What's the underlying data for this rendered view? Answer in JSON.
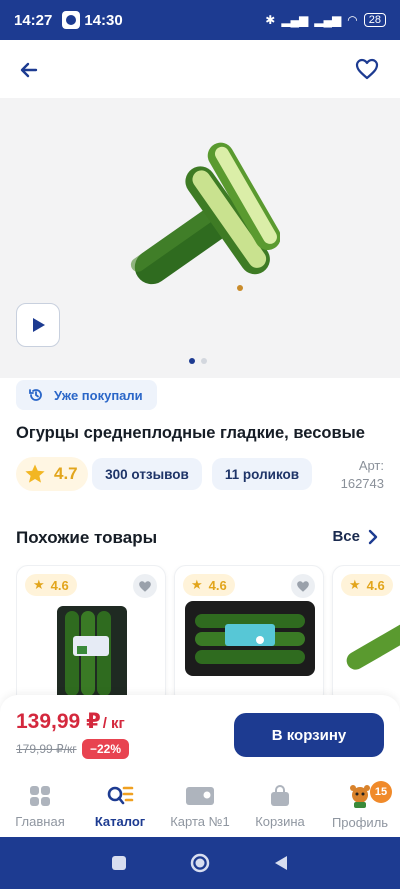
{
  "status_bar": {
    "time": "14:27",
    "second_time": "14:30",
    "battery": "28"
  },
  "icons": {
    "back": "arrow-left-icon",
    "favorite": "heart-outline-icon",
    "play": "play-icon",
    "history": "history-icon",
    "star": "star-icon",
    "chevron": "chevron-right-icon"
  },
  "product": {
    "already_bought": "Уже покупали",
    "title": "Огурцы среднеплодные гладкие, весовые",
    "rating": "4.7",
    "reviews": "300 отзывов",
    "videos": "11 роликов",
    "article_label": "Арт:",
    "article_number": "162743"
  },
  "similar": {
    "title": "Похожие товары",
    "see_all": "Все",
    "cards": [
      {
        "rating": "4.6"
      },
      {
        "rating": "4.6"
      },
      {
        "rating": "4.6"
      }
    ]
  },
  "price": {
    "current": "139,99 ₽",
    "unit": "/ кг",
    "old": "179,99 ₽/кг",
    "discount": "−22%",
    "cart_button": "В корзину"
  },
  "bottom_nav": [
    {
      "label": "Главная"
    },
    {
      "label": "Каталог"
    },
    {
      "label": "Карта №1"
    },
    {
      "label": "Корзина"
    },
    {
      "label": "Профиль",
      "badge": "15"
    }
  ],
  "colors": {
    "brand": "#1d3b91",
    "price_red": "#d4283d",
    "rating_yellow": "#e2a51c"
  }
}
